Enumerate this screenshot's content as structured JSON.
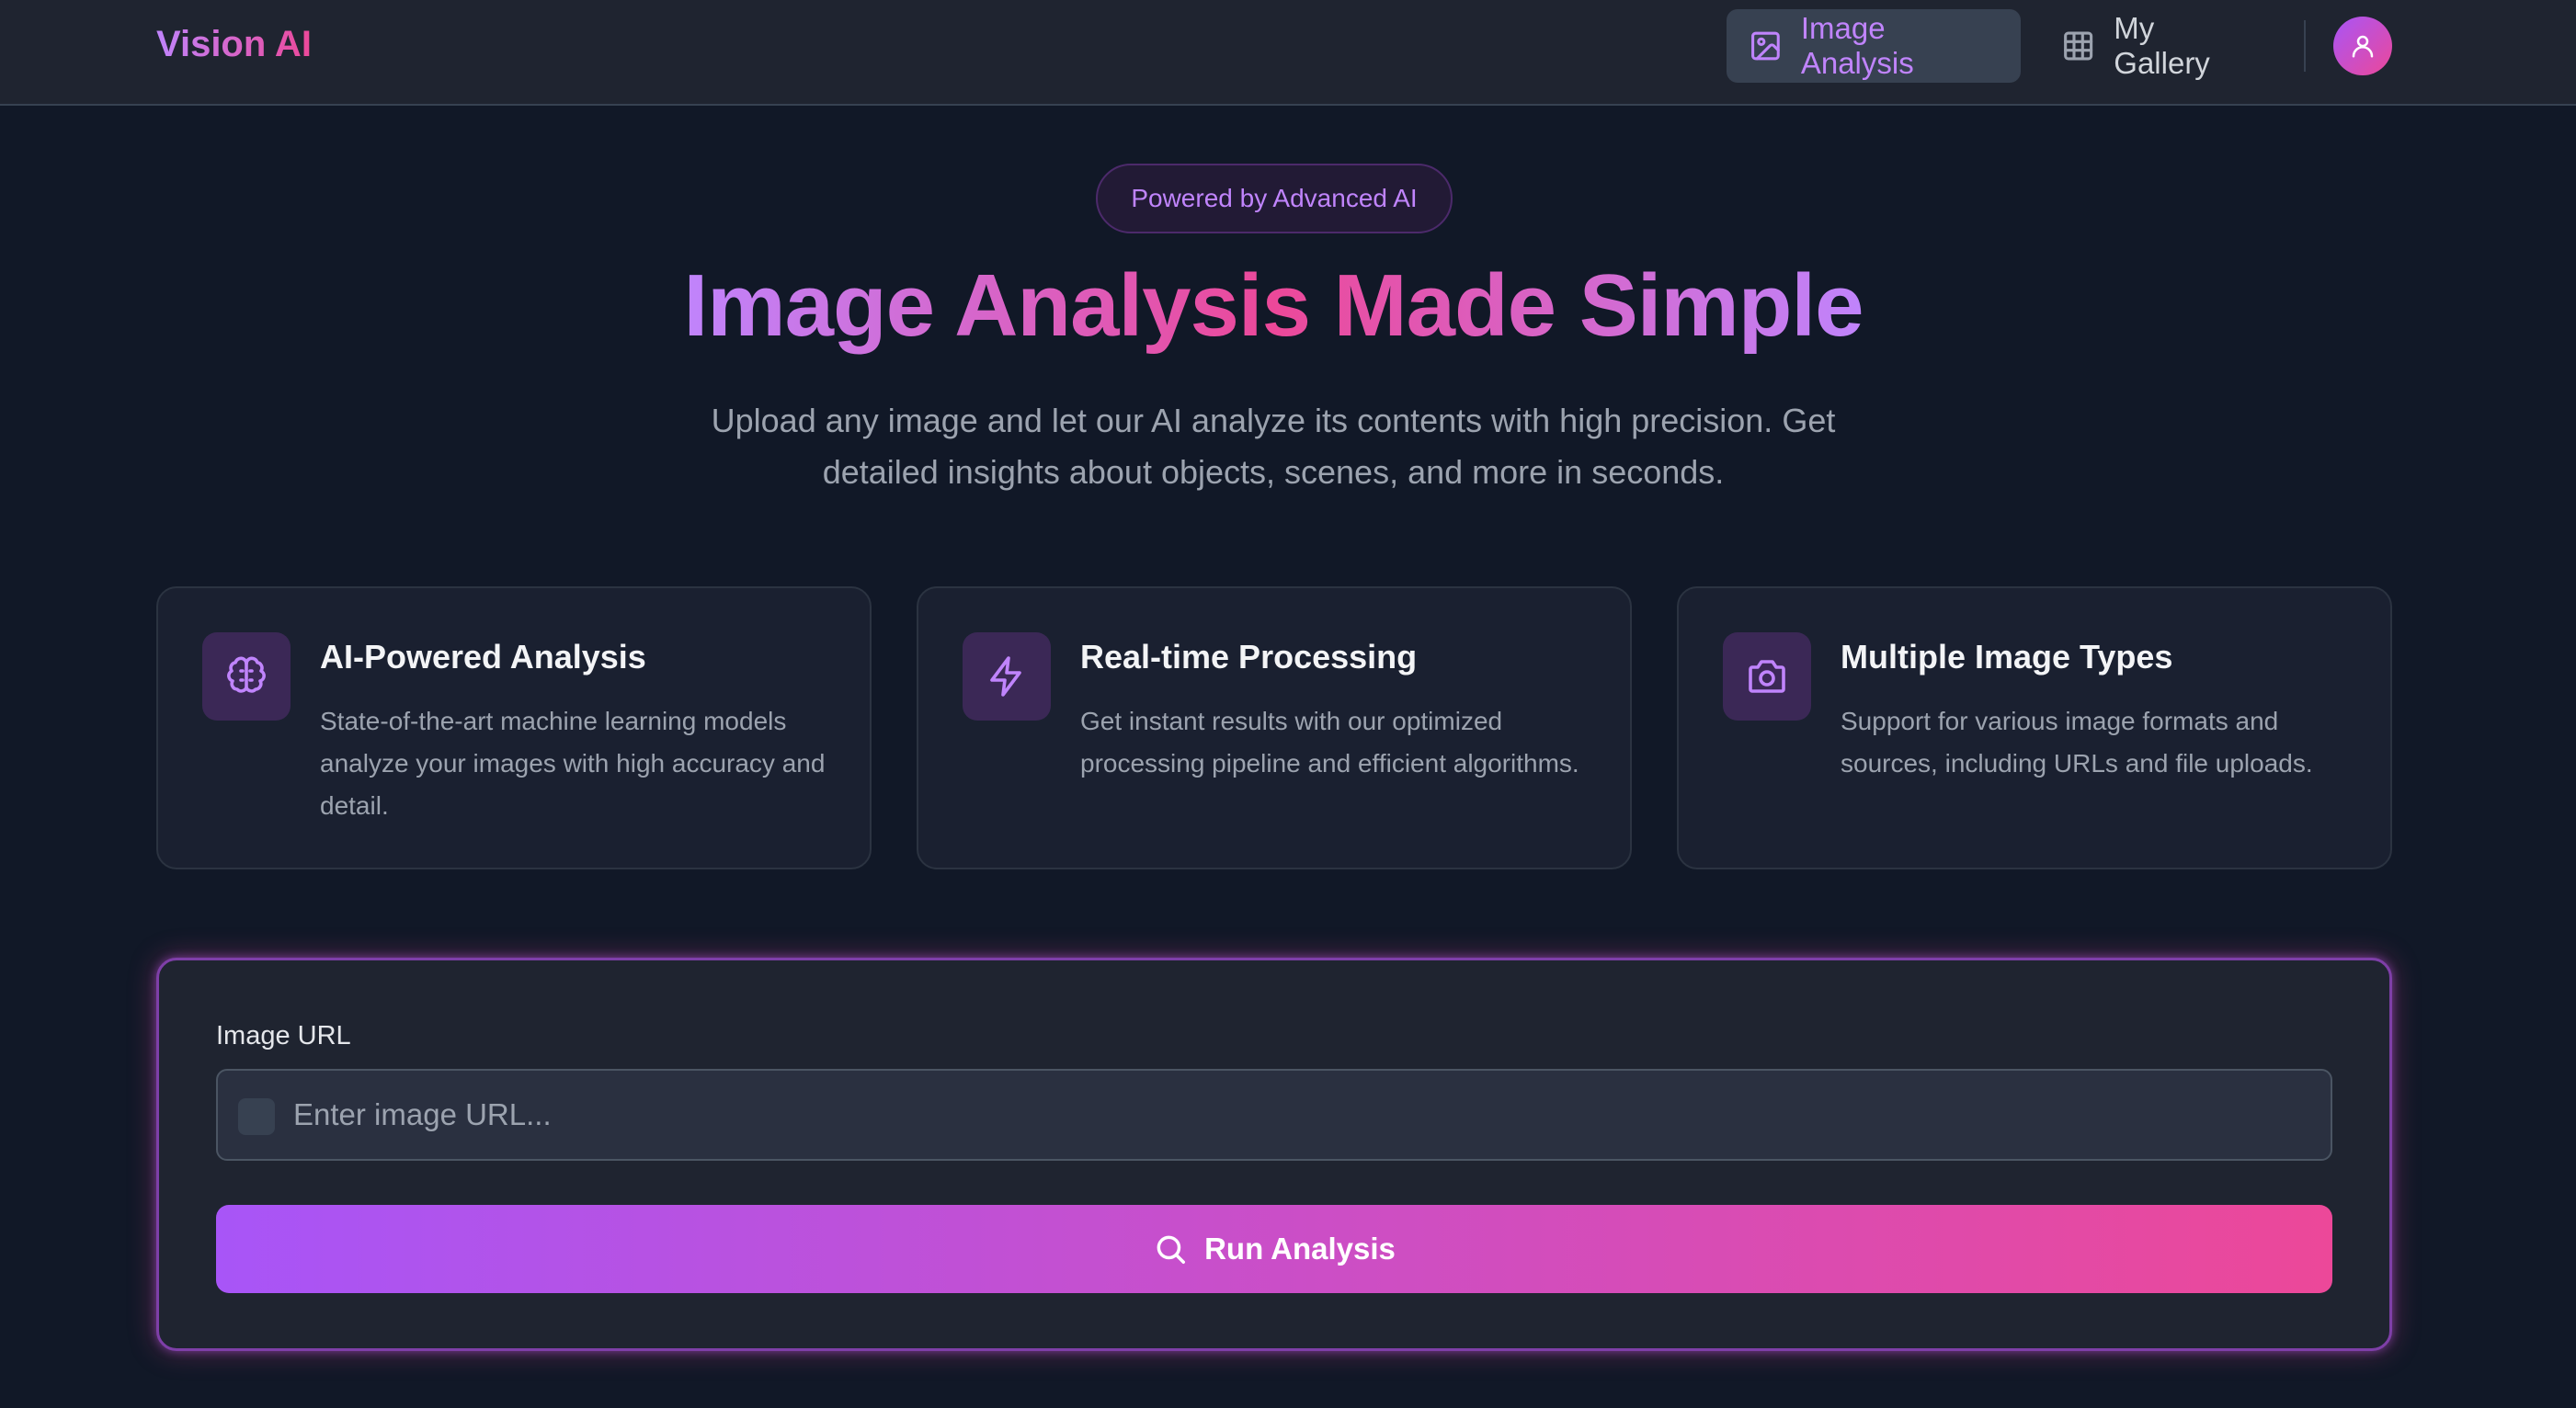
{
  "header": {
    "brand": "Vision AI",
    "nav": [
      {
        "label": "Image Analysis",
        "icon": "image-icon",
        "active": true
      },
      {
        "label": "My Gallery",
        "icon": "grid-icon",
        "active": false
      }
    ],
    "avatar_icon": "user-icon"
  },
  "hero": {
    "badge": "Powered by Advanced AI",
    "title": "Image Analysis Made Simple",
    "subtitle": "Upload any image and let our AI analyze its contents with high precision. Get detailed insights about objects, scenes, and more in seconds."
  },
  "features": [
    {
      "icon": "brain-icon",
      "title": "AI-Powered Analysis",
      "description": "State-of-the-art machine learning models analyze your images with high accuracy and detail."
    },
    {
      "icon": "lightning-icon",
      "title": "Real-time Processing",
      "description": "Get instant results with our optimized processing pipeline and efficient algorithms."
    },
    {
      "icon": "camera-icon",
      "title": "Multiple Image Types",
      "description": "Support for various image formats and sources, including URLs and file uploads."
    }
  ],
  "form": {
    "label": "Image URL",
    "value": "",
    "placeholder": "Enter image URL...",
    "submit_label": "Run Analysis",
    "submit_icon": "search-icon"
  },
  "colors": {
    "accent_purple": "#a855f7",
    "accent_pink": "#ec4899",
    "background": "#111827",
    "surface": "#1f2430"
  }
}
